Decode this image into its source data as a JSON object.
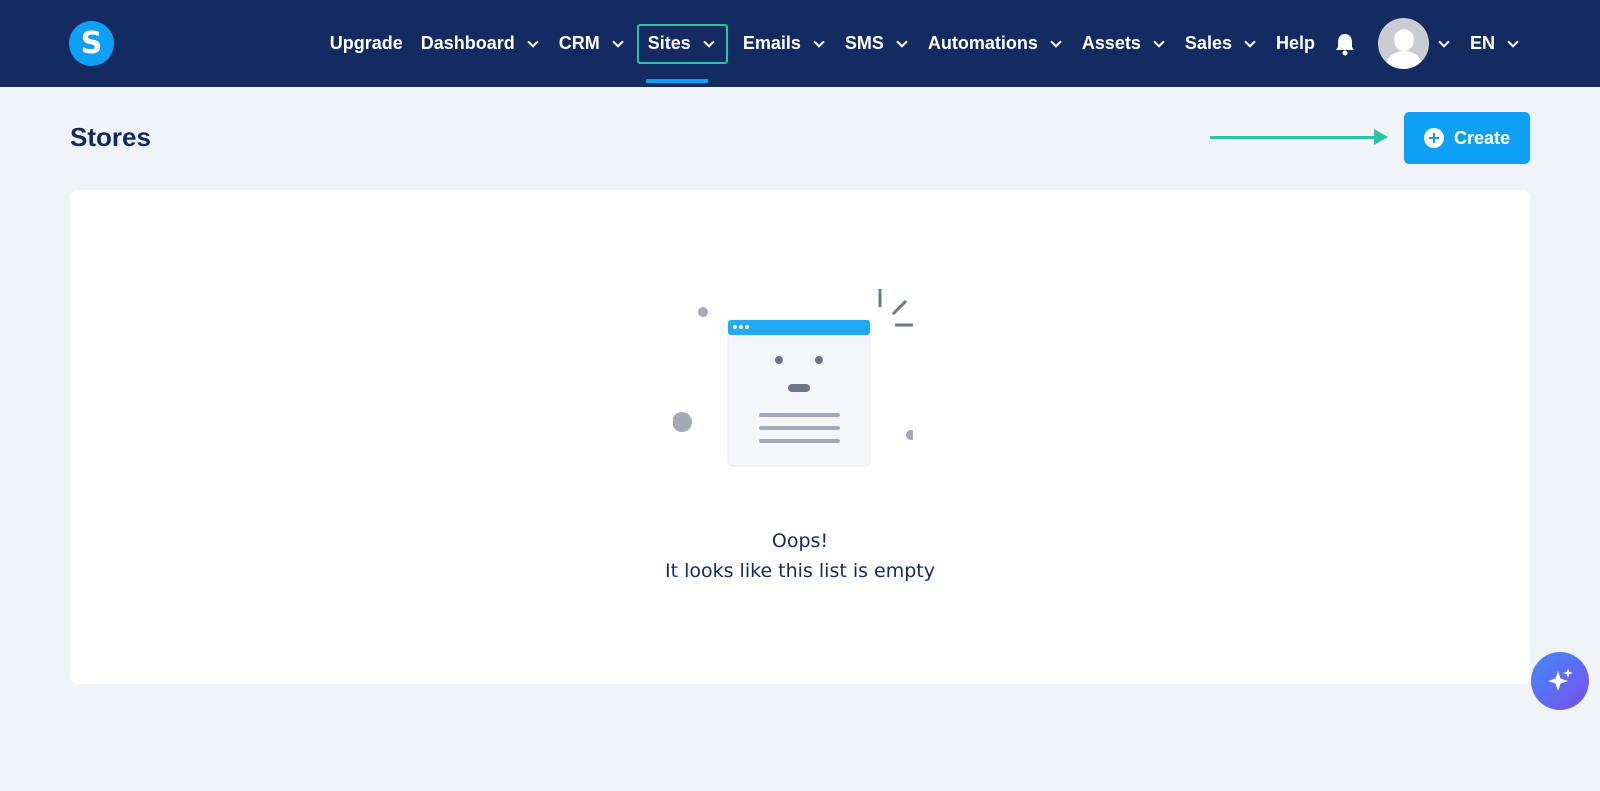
{
  "app": {
    "logo_letter": "S"
  },
  "nav": {
    "items": [
      {
        "label": "Upgrade",
        "dropdown": false
      },
      {
        "label": "Dashboard",
        "dropdown": true
      },
      {
        "label": "CRM",
        "dropdown": true
      },
      {
        "label": "Sites",
        "dropdown": true,
        "active": true
      },
      {
        "label": "Emails",
        "dropdown": true
      },
      {
        "label": "SMS",
        "dropdown": true
      },
      {
        "label": "Automations",
        "dropdown": true
      },
      {
        "label": "Assets",
        "dropdown": true
      },
      {
        "label": "Sales",
        "dropdown": true
      },
      {
        "label": "Help",
        "dropdown": false
      }
    ],
    "language": "EN"
  },
  "page": {
    "title": "Stores",
    "create_label": "Create"
  },
  "empty_state": {
    "line1": "Oops!",
    "line2": "It looks like this list is empty"
  },
  "colors": {
    "nav_bg": "#142b62",
    "accent": "#0ea0f5",
    "highlight": "#2cc4a4"
  }
}
